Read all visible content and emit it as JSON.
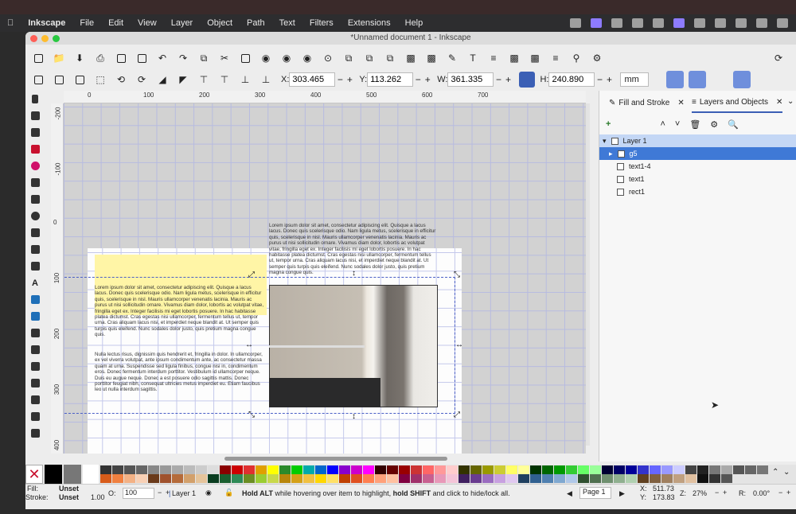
{
  "menubar": {
    "apple": "",
    "app": "Inkscape",
    "items": [
      "File",
      "Edit",
      "View",
      "Layer",
      "Object",
      "Path",
      "Text",
      "Filters",
      "Extensions",
      "Help"
    ]
  },
  "window": {
    "title": "*Unnamed document 1 - Inkscape"
  },
  "toolbar": {
    "x_label": "X:",
    "x_value": "303.465",
    "y_label": "Y:",
    "y_value": "113.262",
    "w_label": "W:",
    "w_value": "361.335",
    "h_label": "H:",
    "h_value": "240.890",
    "unit": "mm"
  },
  "ruler_top": [
    "0",
    "100",
    "200",
    "300",
    "400",
    "500",
    "600",
    "700"
  ],
  "ruler_left": [
    "-200",
    "-100",
    "0",
    "100",
    "200",
    "300",
    "400"
  ],
  "canvas": {
    "text_right": "Lorem ipsum dolor sit amet, consectetur adipiscing elit. Quisque a lacus lacus. Donec quis scelerisque odio. Nam ligula metus, scelerisque in efficitur quis, scelerisque in nisl. Mauris ullamcorper venenatis lacinia. Mauris ac purus ut nisi sollicitudin ornare. Vivamus diam dolor, lobortis ac volutpat vitae, fringilla eget ex. Integer facilisis mi eget lobortis posuere. In hac habitasse platea dictumst. Cras egestas nisi ullamcorper, fermentum tellus ut, tempor urna. Cras aliquam lacus nisi, et imperdiet neque blandit at. Ut semper quis turpis quis eleifend. Nunc sodales dolor justo, quis pretium magna congue quis.",
    "text_left_p1": "Lorem ipsum dolor sit amet, consectetur adipiscing elit. Quisque a lacus lacus. Donec quis scelerisque odio. Nam ligula metus, scelerisque in efficitur quis, scelerisque in nisl. Mauris ullamcorper venenatis lacinia. Mauris ac purus ut nisi sollicitudin ornare. Vivamus diam dolor, lobortis ac volutpat vitae, fringilla eget ex. Integer facilisis mi eget lobortis posuere. In hac habitasse platea dictumst. Cras egestas nisi ullamcorper, fermentum tellus ut, tempor urna. Cras aliquam lacus nisi, et imperdiet neque blandit at. Ut semper quis turpis quis eleifend. Nunc sodales dolor justo, quis pretium magna congue quis.",
    "text_left_p2": "Nulla lectus risus, dignissim quis hendrerit et, fringilla in dolor. In ullamcorper, ex vel viverra volutpat, ante ipsum condimentum ante, ac consectetur massa quam at urna. Suspendisse sed ligula finibus, congue nisi in, condimentum eros. Donec fermentum interdum porttitor. Vestibulum id ullamcorper neque. Duis eu augue neque. Donec a est posuere odio sagittis mattis. Donec porttitor feugiat nibh, consequat ultricies metus imperdiet eu. Etiam faucibus leo ut nulla interdum sagittis."
  },
  "panel": {
    "tab_fill": "Fill and Stroke",
    "tab_layers": "Layers and Objects",
    "tree": [
      {
        "label": "Layer 1"
      },
      {
        "label": "g5"
      },
      {
        "label": "text1-4"
      },
      {
        "label": "text1"
      },
      {
        "label": "rect1"
      }
    ]
  },
  "status": {
    "fill_label": "Fill:",
    "fill_value": "Unset",
    "stroke_label": "Stroke:",
    "stroke_value": "Unset",
    "stroke_width": "1.00",
    "opacity_label": "O:",
    "opacity_value": "100",
    "layer": "Layer 1",
    "message_bold1": "Hold ALT",
    "message_mid": " while hovering over item to highlight, ",
    "message_bold2": "hold SHIFT",
    "message_end": " and click to hide/lock all.",
    "page": "Page 1",
    "x_label": "X:",
    "x_value": "511.73",
    "y_label": "Y:",
    "y_value": "173.83",
    "z_label": "Z:",
    "zoom": "27%",
    "r_label": "R:",
    "rotation": "0.00°"
  },
  "colors": {
    "accent": "#3b5fb5",
    "selected_row": "#c4d7f5",
    "selected_row_strong": "#3f79d6",
    "highlight_yellow": "#fff5a6"
  }
}
